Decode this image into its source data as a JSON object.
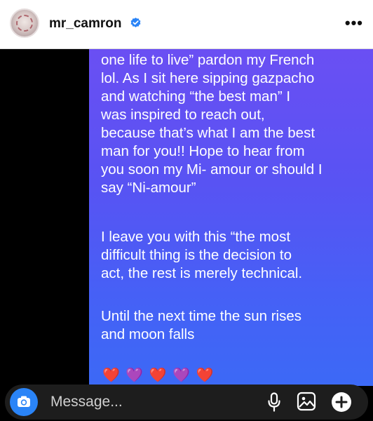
{
  "header": {
    "username": "mr_camron",
    "more_label": "•••"
  },
  "message": {
    "lines": [
      "one life to live” pardon my French",
      "lol. As I sit here sipping gazpacho",
      "and watching “the best man” I",
      "was inspired to reach out,",
      "because that’s what I am the best",
      "man for you!! Hope to hear from",
      "you soon my Mi- amour or should I",
      "say “Ni-amour”",
      "I leave you with this “the most",
      "difficult thing is the decision to",
      "act, the rest is merely technical.",
      "Until the next time the sun rises",
      "and moon falls"
    ],
    "hearts": [
      "❤️",
      "💜",
      "❤️",
      "💜",
      "❤️"
    ]
  },
  "composer": {
    "placeholder": "Message..."
  },
  "icons": {
    "verified": "verified-badge-icon",
    "more": "more-options-icon",
    "camera": "camera-icon",
    "microphone": "microphone-icon",
    "gallery": "gallery-icon",
    "add": "plus-icon"
  },
  "colors": {
    "accent": "#2a84f7",
    "bubble_top": "#6a4ff3",
    "bubble_bottom": "#3c69f6",
    "composer_bg": "#1d1d1d"
  }
}
